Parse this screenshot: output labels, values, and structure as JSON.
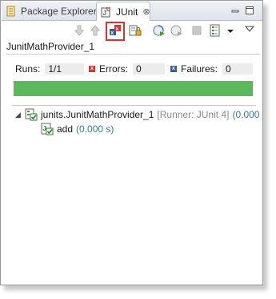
{
  "tabs": {
    "package_explorer": "Package Explorer",
    "junit": "JUnit",
    "close_glyph": "⊗"
  },
  "toolbar": {
    "icons": [
      "next-failure-icon",
      "previous-failure-icon",
      "show-failures-only-icon",
      "scroll-lock-icon",
      "rerun-test-icon",
      "rerun-failures-first-icon",
      "stop-icon",
      "test-run-history-icon",
      "dropdown-icon",
      "view-menu-icon"
    ]
  },
  "panel": {
    "title": "JunitMathProvider_1"
  },
  "stats": {
    "runs_label": "Runs:",
    "runs_value": "1/1",
    "errors_label": "Errors:",
    "errors_value": "0",
    "failures_label": "Failures:",
    "failures_value": "0"
  },
  "progress": {
    "fraction": 1.0,
    "color": "#5cb85c"
  },
  "tree": {
    "root": {
      "label": "junits.JunitMathProvider_1",
      "runner": "[Runner: JUnit 4]",
      "time": "(0.000"
    },
    "child": {
      "label": "add",
      "time": "(0.000 s)"
    }
  },
  "colors": {
    "success": "#5cb85c",
    "error_icon": "#d9342b",
    "failure_icon": "#3b5a9a",
    "highlight": "#d9342b"
  }
}
